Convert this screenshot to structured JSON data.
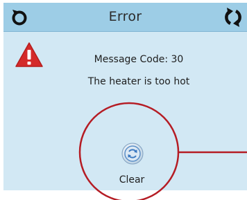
{
  "header": {
    "title": "Error",
    "back_icon": "back-arrow-icon",
    "refresh_icon": "refresh-arrows-icon"
  },
  "message": {
    "icon": "warning-triangle-icon",
    "code_text": "Message Code: 30",
    "description": "The heater is too hot"
  },
  "actions": {
    "clear_label": "Clear",
    "clear_icon": "refresh-circle-icon"
  },
  "colors": {
    "screen_bg": "#d2e8f4",
    "titlebar_bg": "#9dcde6",
    "warning_red": "#d42a2a",
    "callout_red": "#b51c24",
    "icon_blue": "#3a78c0"
  }
}
